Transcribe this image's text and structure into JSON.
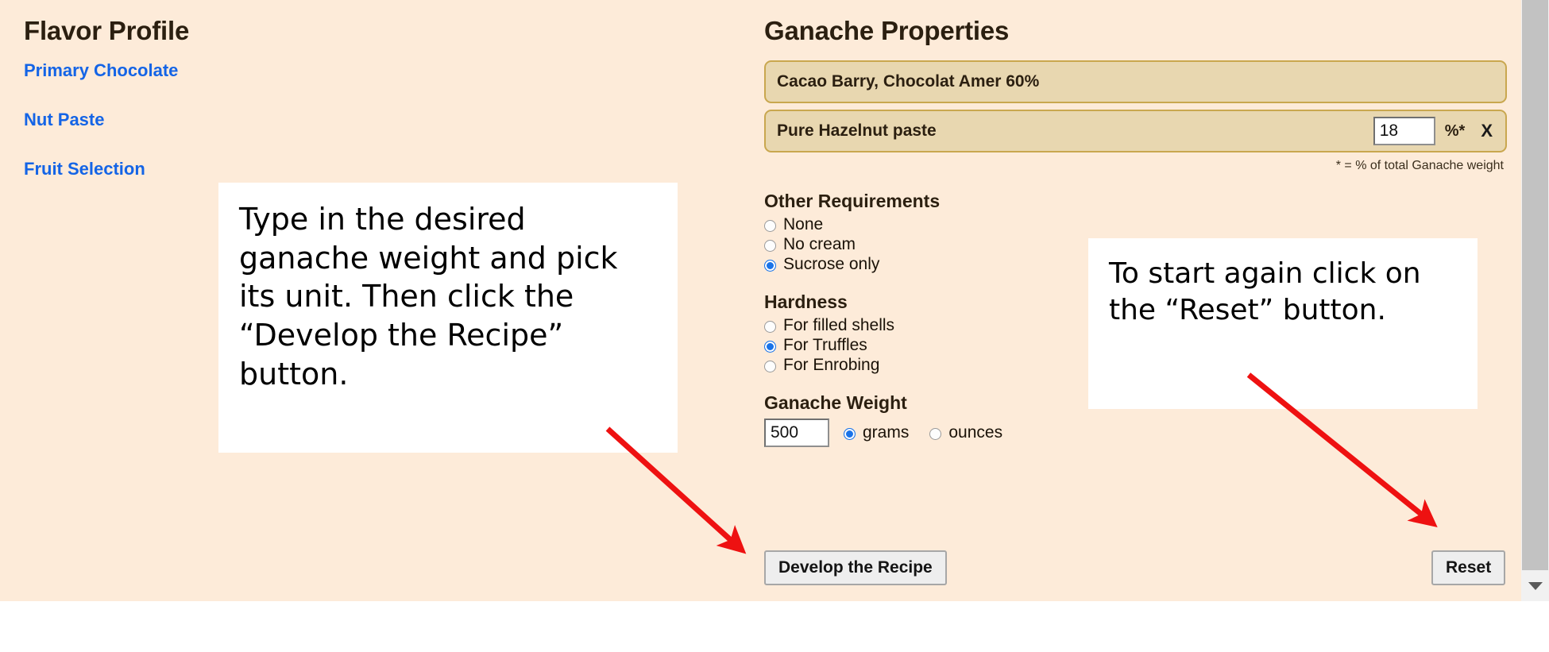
{
  "left_panel": {
    "title": "Flavor Profile",
    "links": [
      {
        "label": "Primary Chocolate"
      },
      {
        "label": "Nut Paste"
      },
      {
        "label": "Fruit Selection"
      }
    ]
  },
  "right_panel": {
    "title": "Ganache Properties",
    "ingredients": [
      {
        "name": "Cacao Barry, Chocolat Amer 60%",
        "has_percent": false
      },
      {
        "name": "Pure Hazelnut paste",
        "has_percent": true,
        "percent": "18",
        "percent_unit": "%*",
        "remove_label": "X"
      }
    ],
    "footnote": "* = % of total Ganache weight",
    "other_requirements": {
      "heading": "Other Requirements",
      "options": [
        {
          "label": "None",
          "selected": false
        },
        {
          "label": "No cream",
          "selected": false
        },
        {
          "label": "Sucrose only",
          "selected": true
        }
      ]
    },
    "hardness": {
      "heading": "Hardness",
      "options": [
        {
          "label": "For filled shells",
          "selected": false
        },
        {
          "label": "For Truffles",
          "selected": true
        },
        {
          "label": "For Enrobing",
          "selected": false
        }
      ]
    },
    "ganache_weight": {
      "heading": "Ganache Weight",
      "value": "500",
      "units": [
        {
          "label": "grams",
          "selected": true
        },
        {
          "label": "ounces",
          "selected": false
        }
      ]
    },
    "develop_button": "Develop the Recipe",
    "reset_button": "Reset"
  },
  "callouts": {
    "left": "Type in the desired ganache weight and pick its unit. Then click  the “Develop the Recipe” button.",
    "right": "To start again click on the “Reset” button."
  },
  "colors": {
    "page_background": "#fdebd9",
    "ingredient_box": "#e8d7b0",
    "ingredient_border": "#c9a74f",
    "link_blue": "#1464e6",
    "heading_brown": "#2b1f10",
    "radio_blue": "#1a73e8",
    "arrow_red": "#ee1111",
    "callout_background": "#ffffff"
  }
}
